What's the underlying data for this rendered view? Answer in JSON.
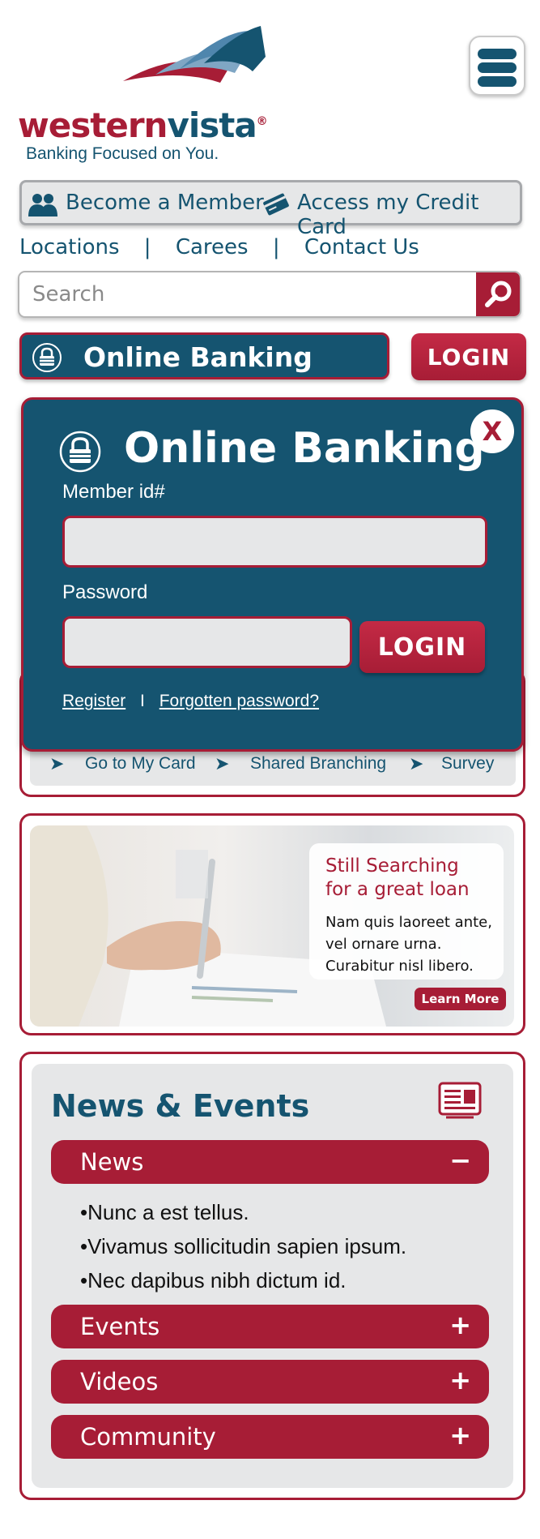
{
  "header": {
    "logo_word_1": "western",
    "logo_word_2": "vista",
    "logo_reg": "®",
    "tagline": "Banking Focused on You."
  },
  "member_bar": {
    "become_member": "Become a Member",
    "access_card": "Access my Credit Card"
  },
  "top_links": {
    "locations": "Locations",
    "separator": "|",
    "careers": "Carees",
    "contact": "Contact Us"
  },
  "search": {
    "placeholder": "Search"
  },
  "online_banking": {
    "bar_label": "Online Banking",
    "login_label": "LOGIN"
  },
  "modal": {
    "close_label": "X",
    "title": "Online Banking",
    "member_label": "Member id#",
    "password_label": "Password",
    "login_label": "LOGIN",
    "register": "Register",
    "separator": "I",
    "forgot": "Forgotten password?"
  },
  "quick_links": {
    "arrow": "➤",
    "items": [
      "Go to My Card",
      "Shared Branching",
      "Survey"
    ]
  },
  "promo": {
    "heading_1": "Still Searching",
    "heading_2": "for a great loan",
    "body_1": "Nam quis laoreet ante,",
    "body_2": "vel ornare urna.",
    "body_3": "Curabitur nisl libero.",
    "button": "Learn More"
  },
  "news": {
    "title": "News & Events",
    "sections": [
      {
        "label": "News",
        "sign": "−",
        "expanded": true
      },
      {
        "label": "Events",
        "sign": "+"
      },
      {
        "label": "Videos",
        "sign": "+"
      },
      {
        "label": "Community",
        "sign": "+"
      }
    ],
    "items": [
      "Nunc a est tellus.",
      "Vivamus sollicitudin sapien ipsum.",
      "Nec dapibus nibh dictum id."
    ]
  },
  "colors": {
    "brand_red": "#a71d36",
    "brand_blue": "#155470",
    "panel_gray": "#e6e7e8"
  }
}
